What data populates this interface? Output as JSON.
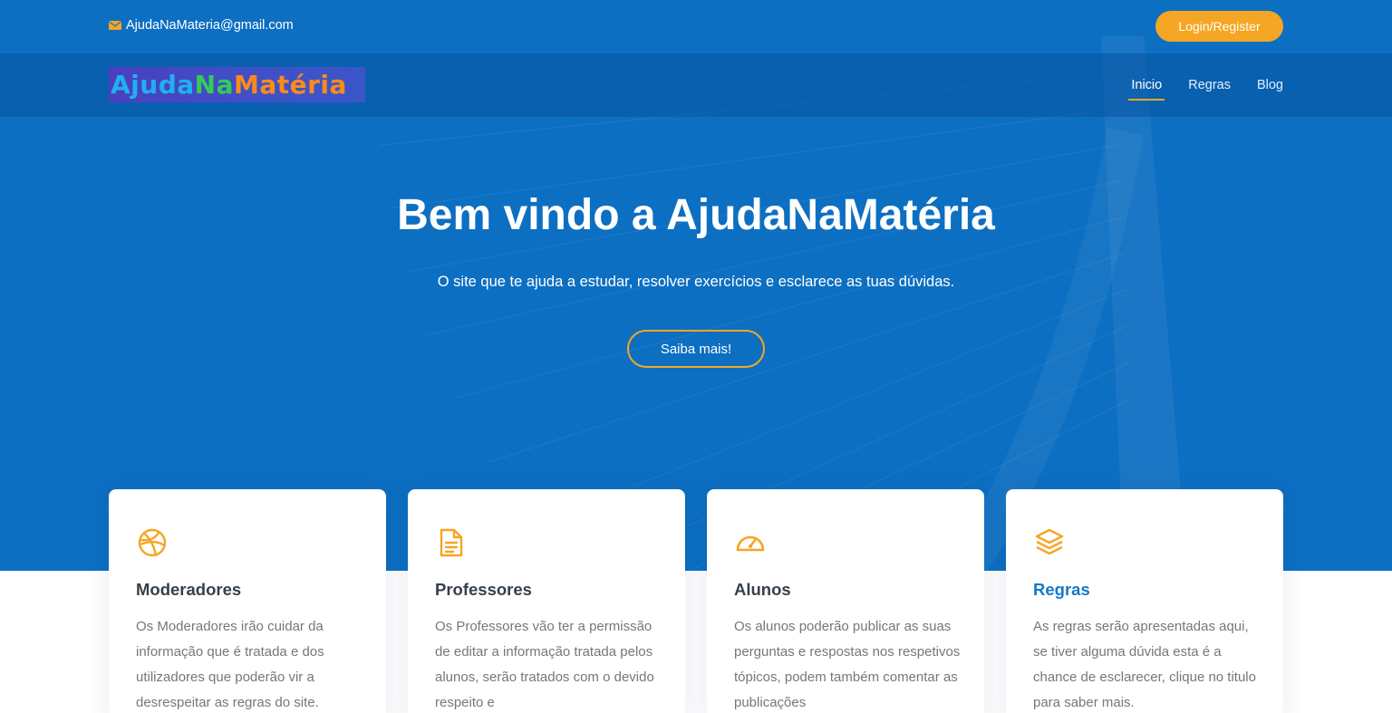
{
  "topbar": {
    "email": "AjudaNaMateria@gmail.com",
    "email_icon": "envelope-icon",
    "login_label": "Login/Register"
  },
  "navbar": {
    "logo": {
      "part1": "Ajuda",
      "part2": "Na",
      "part3": "Matéria"
    },
    "links": [
      {
        "label": "Inicio",
        "active": true
      },
      {
        "label": "Regras",
        "active": false
      },
      {
        "label": "Blog",
        "active": false
      }
    ]
  },
  "hero": {
    "title": "Bem vindo a AjudaNaMatéria",
    "subtitle": "O site que te ajuda a estudar, resolver exercícios e esclarece as tuas dúvidas.",
    "button_label": "Saiba mais!"
  },
  "cards": [
    {
      "icon": "dribbble-icon",
      "title": "Moderadores",
      "text": "Os Moderadores irão cuidar da informação que é tratada e dos utilizadores que poderão vir a desrespeitar as regras do site."
    },
    {
      "icon": "document-icon",
      "title": "Professores",
      "text": "Os Professores vão ter a permissão de editar a informação tratada pelos alunos, serão tratados com o devido respeito e"
    },
    {
      "icon": "speedometer-icon",
      "title": "Alunos",
      "text": "Os alunos poderão publicar as suas perguntas e respostas nos respetivos tópicos, podem também comentar as publicações"
    },
    {
      "icon": "layers-icon",
      "title": "Regras",
      "text": "As regras serão apresentadas aqui, se tiver alguma dúvida esta é a chance de esclarecer, clique no titulo para saber mais."
    }
  ],
  "colors": {
    "hero_background": "#0d6fc2",
    "accent": "#f5a623",
    "card_title": "#37404a",
    "card_title_link": "#1878c8",
    "card_text": "#777777"
  }
}
